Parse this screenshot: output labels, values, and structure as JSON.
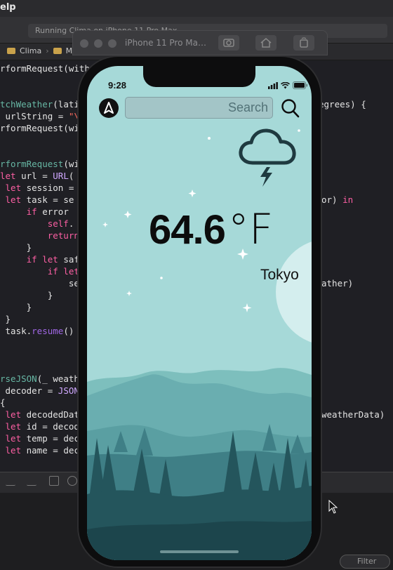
{
  "xcode": {
    "menu_title": "elp",
    "activity": "Running Clima on iPhone 11 Pro Max",
    "breadcrumbs": [
      "Clima",
      "M"
    ],
    "filter_placeholder": "Filter"
  },
  "simulator": {
    "title": "iPhone 11 Pro Ma…"
  },
  "app": {
    "status_time": "9:28",
    "search_placeholder": "Search",
    "temperature_value": "64.6",
    "temperature_unit": "°F",
    "city": "Tokyo",
    "condition_icon": "cloud-bolt-icon",
    "colors": {
      "sky": "#a6d9d8",
      "accent_dark": "#1f3a40",
      "text": "#0c0c0c"
    }
  }
}
